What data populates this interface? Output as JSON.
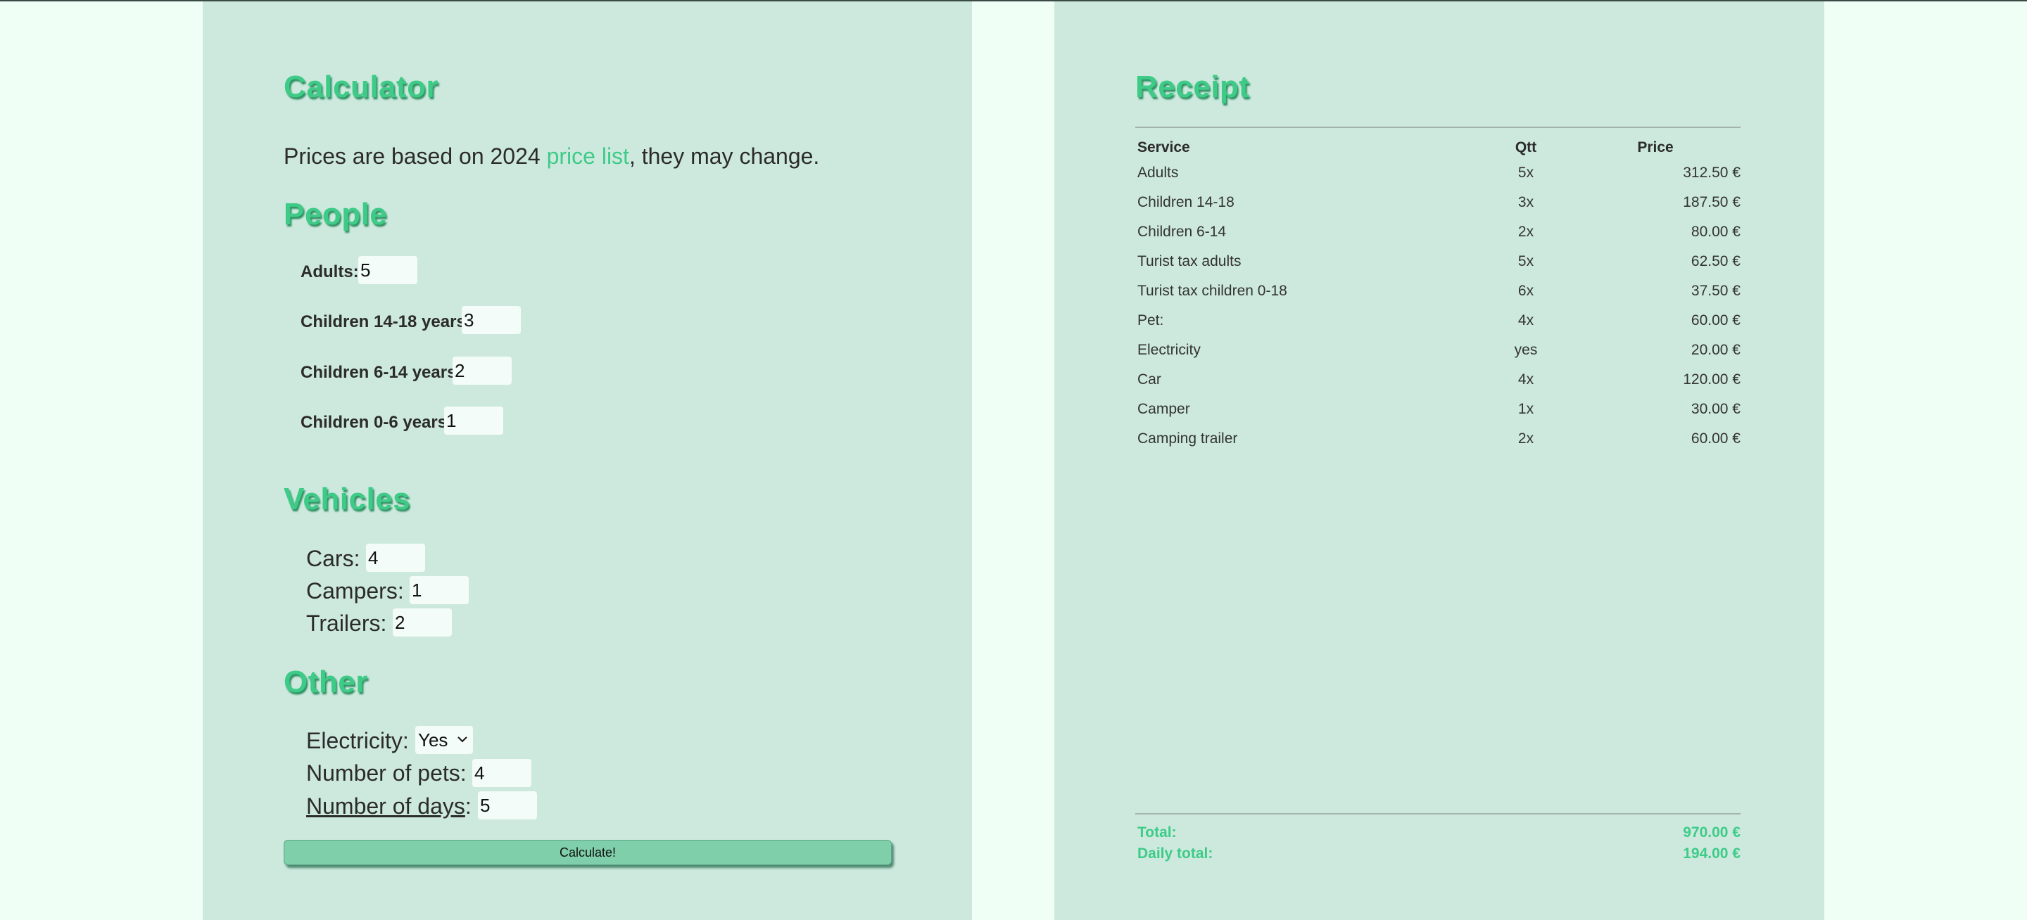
{
  "calculator": {
    "title": "Calculator",
    "intro_before": "Prices are based on 2024 ",
    "intro_link": "price list",
    "intro_after": ", they may change.",
    "people": {
      "title": "People",
      "adults_label": "Adults:",
      "adults_value": "5",
      "children_14_18_label": "Children 14-18 years:",
      "children_14_18_value": "3",
      "children_6_14_label": "Children 6-14 years:",
      "children_6_14_value": "2",
      "children_0_6_label": "Children 0-6 years:",
      "children_0_6_value": "1"
    },
    "vehicles": {
      "title": "Vehicles",
      "cars_label": "Cars:",
      "cars_value": "4",
      "campers_label": "Campers:",
      "campers_value": "1",
      "trailers_label": "Trailers:",
      "trailers_value": "2"
    },
    "other": {
      "title": "Other",
      "electricity_label": "Electricity:",
      "electricity_value": "Yes",
      "pets_label": "Number of pets:",
      "pets_value": "4",
      "days_label": "Number of days",
      "days_colon": ":",
      "days_value": "5"
    },
    "calculate_label": "Calculate!"
  },
  "receipt": {
    "title": "Receipt",
    "headers": {
      "service": "Service",
      "qtt": "Qtt",
      "price": "Price"
    },
    "rows": [
      {
        "service": "Adults",
        "qtt": "5x",
        "price": "312.50 €"
      },
      {
        "service": "Children 14-18",
        "qtt": "3x",
        "price": "187.50 €"
      },
      {
        "service": "Children 6-14",
        "qtt": "2x",
        "price": "80.00 €"
      },
      {
        "service": "Turist tax adults",
        "qtt": "5x",
        "price": "62.50 €"
      },
      {
        "service": "Turist tax children 0-18",
        "qtt": "6x",
        "price": "37.50 €"
      },
      {
        "service": "Pet:",
        "qtt": "4x",
        "price": "60.00 €"
      },
      {
        "service": "Electricity",
        "qtt": "yes",
        "price": "20.00 €"
      },
      {
        "service": "Car",
        "qtt": "4x",
        "price": "120.00 €"
      },
      {
        "service": "Camper",
        "qtt": "1x",
        "price": "30.00 €"
      },
      {
        "service": "Camping trailer",
        "qtt": "2x",
        "price": "60.00 €"
      }
    ],
    "total_label": "Total:",
    "total_value": "970.00 €",
    "daily_total_label": "Daily total:",
    "daily_total_value": "194.00 €"
  },
  "colors": {
    "page_background": "#f0fff6",
    "panel_background": "#cde9de",
    "accent": "#3dcb87",
    "button": "#7ecfaa"
  }
}
